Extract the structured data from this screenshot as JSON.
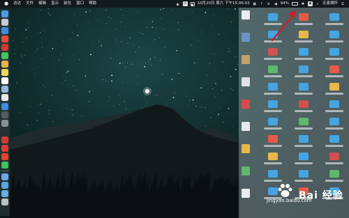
{
  "menubar": {
    "apple": "",
    "items": [
      "访达",
      "文件",
      "编辑",
      "显示",
      "前往",
      "窗口",
      "帮助"
    ],
    "status": {
      "date_time": "10月20日 周六 下午15:06:03",
      "battery": "94%",
      "wifi_name": "无患满怀"
    }
  },
  "dock": {
    "icons": [
      {
        "name": "finder-icon",
        "color": "#4a9be8"
      },
      {
        "name": "launchpad-icon",
        "color": "#c9ccd2"
      },
      {
        "name": "safari-icon",
        "color": "#3c8be0"
      },
      {
        "name": "chrome-icon",
        "color": "#e64a3b"
      },
      {
        "name": "red-app-icon",
        "color": "#d13a2e"
      },
      {
        "name": "messages-icon",
        "color": "#46c35a"
      },
      {
        "name": "photos-icon",
        "color": "#e7b347"
      },
      {
        "name": "notes-icon",
        "color": "#f2d65c"
      },
      {
        "name": "calendar-icon",
        "color": "#ffffff"
      },
      {
        "name": "preview-icon",
        "color": "#95b8de"
      },
      {
        "name": "textedit-icon",
        "color": "#e7e7e7"
      },
      {
        "name": "appstore-icon",
        "color": "#3a8ee6"
      },
      {
        "name": "activity-icon",
        "color": "#555b60"
      },
      {
        "name": "system-prefs-icon",
        "color": "#8a8f95"
      },
      {
        "name": "terminal-icon",
        "color": "#2b2f33"
      },
      {
        "name": "netease-music-icon",
        "color": "#d43a31"
      },
      {
        "name": "weibo-icon",
        "color": "#dd3a33"
      },
      {
        "name": "yandex-icon",
        "color": "#e84031"
      },
      {
        "name": "wechat-icon",
        "color": "#3ec55a"
      },
      {
        "name": "cloud-icon",
        "color": "#6aa6e8"
      },
      {
        "name": "folder-icon",
        "color": "#5aa5e6"
      },
      {
        "name": "downloads-icon",
        "color": "#64aee9"
      },
      {
        "name": "trash-icon",
        "color": "#b9c0c6"
      }
    ]
  },
  "watermark": {
    "brand": "Bai  经验",
    "url": "jingyan.baidu.com"
  },
  "colors": {
    "arrow": "#d21b2a",
    "panel": "#a3b2b6",
    "folder": "#46a4e0"
  }
}
